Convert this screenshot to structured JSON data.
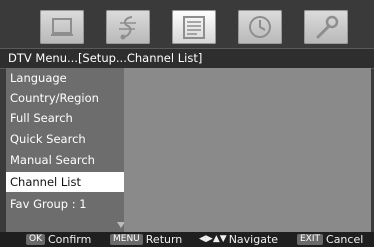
{
  "tabs": [
    {
      "name": "picture",
      "icon": "tv-screen-icon",
      "active": false
    },
    {
      "name": "audio",
      "icon": "music-note-icon",
      "active": false
    },
    {
      "name": "setup",
      "icon": "document-list-icon",
      "active": true
    },
    {
      "name": "time",
      "icon": "clock-icon",
      "active": false
    },
    {
      "name": "settings",
      "icon": "wrench-icon",
      "active": false
    }
  ],
  "header": {
    "title": "DTV Menu...[Setup...Channel List]"
  },
  "menu": {
    "items": [
      {
        "label": "Language",
        "selected": false
      },
      {
        "label": "Country/Region",
        "selected": false
      },
      {
        "label": "Full Search",
        "selected": false
      },
      {
        "label": "Quick Search",
        "selected": false
      },
      {
        "label": "Manual Search",
        "selected": false
      },
      {
        "label": "Channel List",
        "selected": true
      },
      {
        "label": "Fav Group : 1",
        "selected": false
      }
    ]
  },
  "footer": {
    "ok_key": "OK",
    "ok_label": "Confirm",
    "menu_key": "MENU",
    "menu_label": "Return",
    "nav_label": "Navigate",
    "exit_key": "EXIT",
    "exit_label": "Cancel"
  }
}
